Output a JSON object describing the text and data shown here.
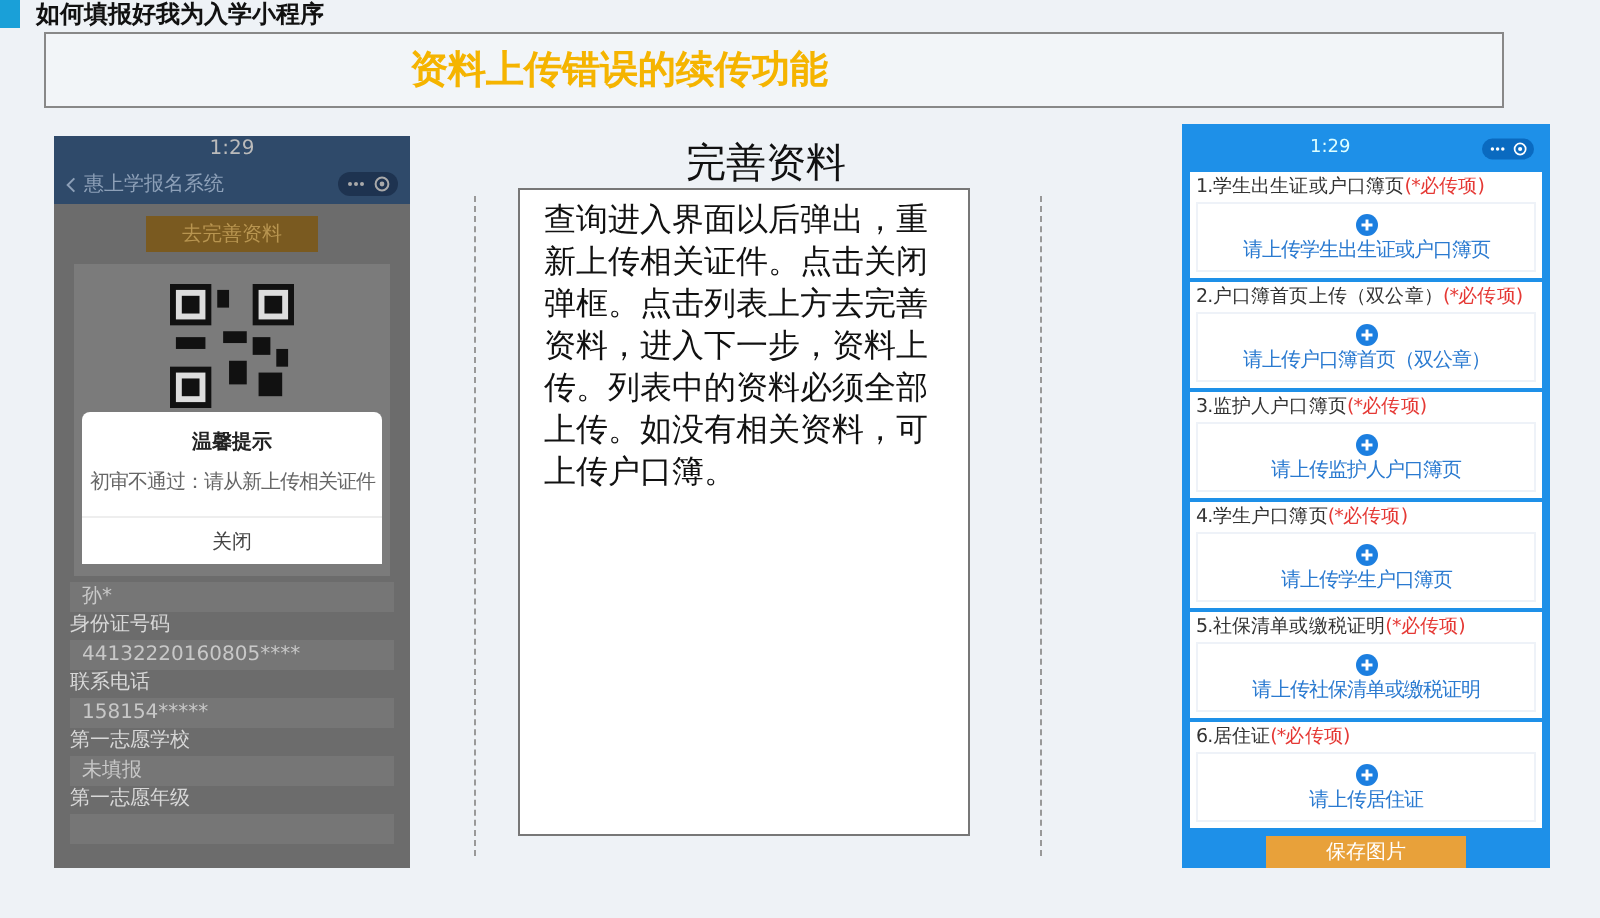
{
  "page_title": "如何填报好我为入学小程序",
  "banner": {
    "title": "资料上传错误的续传功能"
  },
  "left_phone": {
    "status_time": "1:29",
    "nav_title": "惠上学报名系统",
    "top_button": "去完善资料",
    "dialog": {
      "title": "温馨提示",
      "message": "初审不通过：请从新上传相关证件",
      "button": "关闭"
    },
    "fields": [
      {
        "value": "孙*"
      },
      {
        "label": "身份证号码",
        "value": "44132220160805****"
      },
      {
        "label": "联系电话",
        "value": "158154*****"
      },
      {
        "label": "第一志愿学校",
        "value": "未填报"
      },
      {
        "label": "第一志愿年级"
      }
    ]
  },
  "middle": {
    "heading": "完善资料",
    "description": "查询进入界面以后弹出，重新上传相关证件。点击关闭弹框。点击列表上方去完善资料，进入下一步，资料上传。列表中的资料必须全部上传。如没有相关资料，可上传户口簿。"
  },
  "right_phone": {
    "status_time": "1:29",
    "sections": [
      {
        "title": "1.学生出生证或户口簿页",
        "required": "(*必传项)",
        "hint": "请上传学生出生证或户口簿页"
      },
      {
        "title": "2.户口簿首页上传（双公章）",
        "required": "(*必传项)",
        "hint": "请上传户口簿首页（双公章）"
      },
      {
        "title": "3.监护人户口簿页",
        "required": "(*必传项)",
        "hint": "请上传监护人户口簿页"
      },
      {
        "title": "4.学生户口簿页",
        "required": "(*必传项)",
        "hint": "请上传学生户口簿页"
      },
      {
        "title": "5.社保清单或缴税证明",
        "required": "(*必传项)",
        "hint": "请上传社保清单或缴税证明"
      },
      {
        "title": "6.居住证",
        "required": "(*必传项)",
        "hint": "请上传居住证"
      }
    ],
    "save_button": "保存图片"
  }
}
